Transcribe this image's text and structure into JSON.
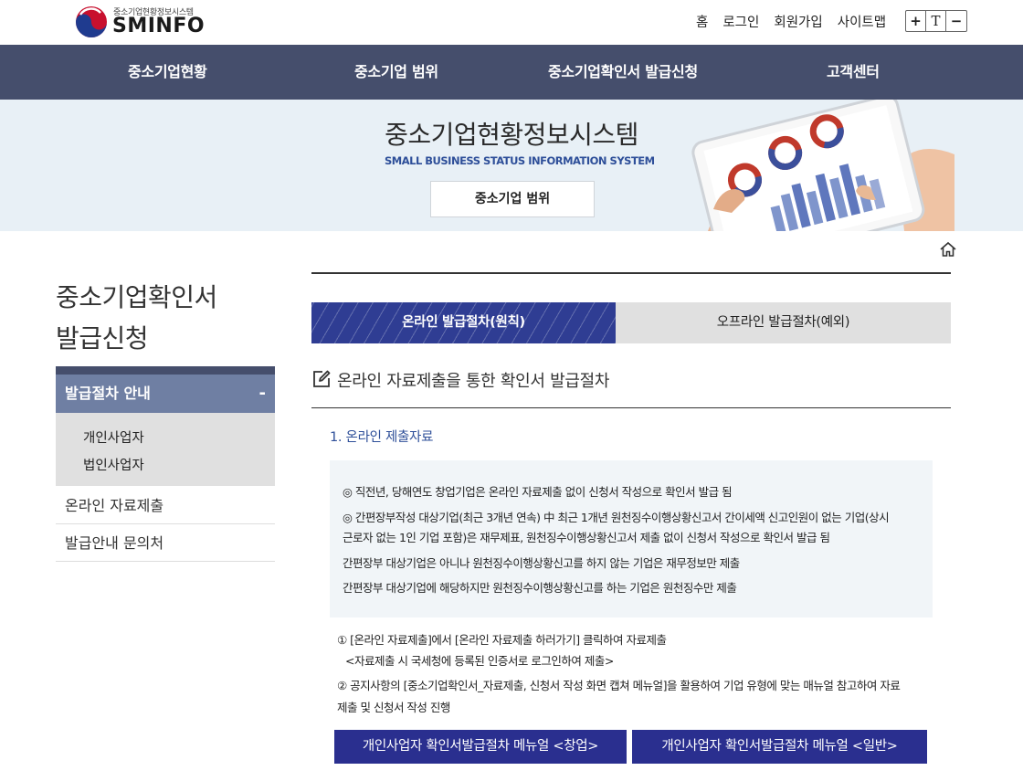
{
  "header": {
    "logo_sub": "중소기업현황정보시스템",
    "logo_main": "SMINFO",
    "util_links": [
      "홈",
      "로그인",
      "회원가입",
      "사이트맵"
    ],
    "font_controls": [
      "+",
      "T",
      "−"
    ]
  },
  "gnb": {
    "items": [
      "중소기업현황",
      "중소기업 범위",
      "중소기업확인서 발급신청",
      "고객센터"
    ]
  },
  "visual": {
    "title": "중소기업현황정보시스템",
    "subtitle": "SMALL BUSINESS STATUS INFORMATION SYSTEM",
    "button": "중소기업 범위"
  },
  "sidebar": {
    "title_line1": "중소기업확인서",
    "title_line2": "발급신청",
    "active_item": "발급절차 안내",
    "active_toggle": "-",
    "sub_items": [
      "개인사업자",
      "법인사업자"
    ],
    "items": [
      "온라인 자료제출",
      "발급안내 문의처"
    ]
  },
  "content": {
    "tabs": [
      "온라인 발급절차(원칙)",
      "오프라인 발급절차(예외)"
    ],
    "section_title": "온라인 자료제출을 통한 확인서 발급절차",
    "sub_heading": "1. 온라인 제출자료",
    "info_lines": [
      "◎ 직전년, 당해연도 창업기업은 온라인 자료제출 없이 신청서 작성으로 확인서 발급 됨",
      "◎ 간편장부작성 대상기업(최근 3개년 연속) 中 최근 1개년 원천징수이행상황신고서 간이세액 신고인원이 없는 기업(상시",
      "근로자 없는 1인 기업 포함)은 재무제표, 원천징수이행상황신고서 제출 없이 신청서 작성으로 확인서 발급 됨",
      "간편장부 대상기업은 아니나 원천징수이행상황신고를 하지 않는 기업은 재무정보만 제출",
      "간편장부 대상기업에 해당하지만 원천징수이행상황신고를 하는 기업은 원천징수만 제출"
    ],
    "steps": [
      "① [온라인 자료제출]에서 [온라인 자료제출 하러가기] 클릭하여 자료제출",
      "  <자료제출 시 국세청에 등록된 인증서로 로그인하여 제출>",
      "② 공지사항의 [중소기업확인서_자료제출, 신청서 작성 화면 캡쳐 메뉴얼]을 활용하여 기업 유형에 맞는 매뉴얼 참고하여 자료",
      "제출 및 신청서 작성 진행"
    ],
    "manual_buttons": [
      "개인사업자 확인서발급절차 메뉴얼 <창업>",
      "개인사업자 확인서발급절차 메뉴얼 <일반>"
    ]
  },
  "colors": {
    "gnb_bg": "#454e6c",
    "accent_blue": "#2e4f99",
    "tab_active": "#2f3d93",
    "button_bg": "#2a2f8f",
    "sidebar_active": "#6f7fa3"
  }
}
